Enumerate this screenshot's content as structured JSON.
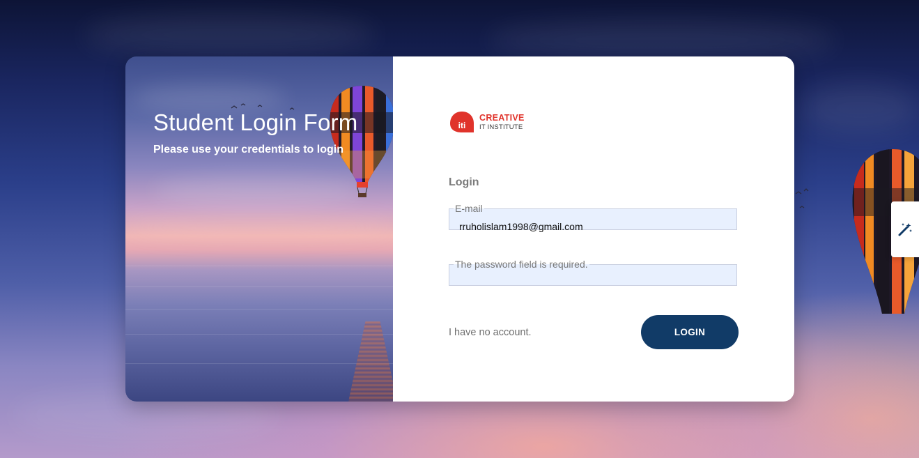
{
  "panel": {
    "title": "Student Login Form",
    "subtitle": "Please use your credentials to login"
  },
  "logo": {
    "brand": "CREATIVE",
    "sub": "IT INSTITUTE",
    "mark": "iti",
    "brand_color": "#e0332b"
  },
  "form": {
    "heading": "Login",
    "email": {
      "legend": "E-mail",
      "value": "rruholislam1998@gmail.com"
    },
    "password": {
      "legend": "The password field is required.",
      "value": ""
    },
    "no_account_link": "I have no account.",
    "login_button": "LOGIN"
  },
  "floating_tool": {
    "icon": "magic-wand-icon"
  },
  "colors": {
    "button_bg": "#113b67",
    "input_bg": "#e8f0fe",
    "heading_text": "#7a7a7a"
  }
}
